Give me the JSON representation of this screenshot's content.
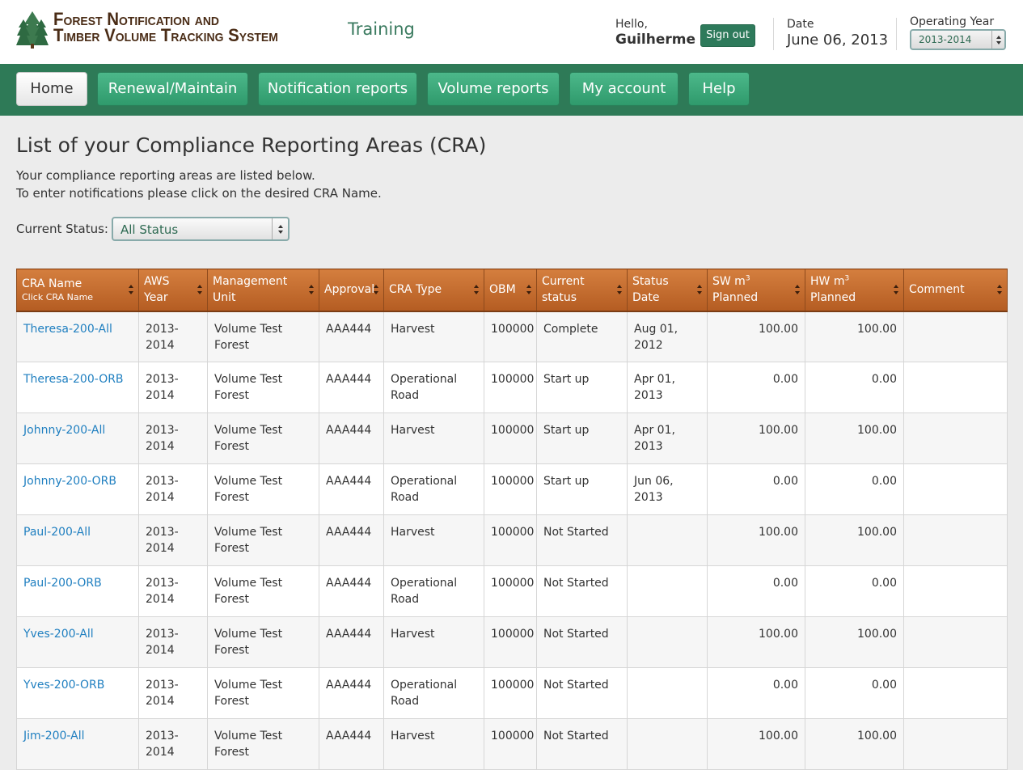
{
  "header": {
    "logo_line1": "Forest Notification and",
    "logo_line2": "Timber Volume Tracking System",
    "environment": "Training",
    "hello_label": "Hello,",
    "user_name": "Guilherme",
    "signout_label": "Sign out",
    "date_label": "Date",
    "date_value": "June 06, 2013",
    "operating_year_label": "Operating Year",
    "operating_year_value": "2013-2014"
  },
  "nav": {
    "items": [
      {
        "label": "Home",
        "active": true
      },
      {
        "label": "Renewal/Maintain"
      },
      {
        "label": "Notification reports"
      },
      {
        "label": "Volume reports"
      },
      {
        "label": "My account"
      },
      {
        "label": "Help"
      }
    ]
  },
  "main": {
    "title": "List of your Compliance Reporting Areas (CRA)",
    "intro_line1": "Your compliance reporting areas are listed below.",
    "intro_line2": "To enter notifications please click on the desired CRA Name.",
    "status_filter_label": "Current Status:",
    "status_filter_value": "All Status"
  },
  "table": {
    "headers": {
      "cra_name": "CRA Name",
      "cra_name_sub": "Click CRA Name",
      "aws_year_1": "AWS",
      "aws_year_2": "Year",
      "management_unit": "Management Unit",
      "approval": "Approval",
      "cra_type": "CRA Type",
      "obm": "OBM",
      "current_status_1": "Current",
      "current_status_2": "status",
      "status_date": "Status Date",
      "sw_1": "SW m",
      "sw_sup": "3",
      "sw_2": "Planned",
      "hw_1": "HW m",
      "hw_sup": "3",
      "hw_2": "Planned",
      "comment": "Comment"
    },
    "rows": [
      {
        "cra_name": "Theresa-200-All",
        "aws_year_1": "2013-",
        "aws_year_2": "2014",
        "mu_1": "Volume Test",
        "mu_2": "Forest",
        "approval": "AAA444",
        "type_1": "Harvest",
        "type_2": "",
        "obm": "100000",
        "status": "Complete",
        "status_date": "Aug 01, 2012",
        "sw": "100.00",
        "hw": "100.00",
        "comment": ""
      },
      {
        "cra_name": "Theresa-200-ORB",
        "aws_year_1": "2013-",
        "aws_year_2": "2014",
        "mu_1": "Volume Test",
        "mu_2": "Forest",
        "approval": "AAA444",
        "type_1": "Operational",
        "type_2": "Road",
        "obm": "100000",
        "status": "Start up",
        "status_date": "Apr 01, 2013",
        "sw": "0.00",
        "hw": "0.00",
        "comment": ""
      },
      {
        "cra_name": "Johnny-200-All",
        "aws_year_1": "2013-",
        "aws_year_2": "2014",
        "mu_1": "Volume Test",
        "mu_2": "Forest",
        "approval": "AAA444",
        "type_1": "Harvest",
        "type_2": "",
        "obm": "100000",
        "status": "Start up",
        "status_date": "Apr 01, 2013",
        "sw": "100.00",
        "hw": "100.00",
        "comment": ""
      },
      {
        "cra_name": "Johnny-200-ORB",
        "aws_year_1": "2013-",
        "aws_year_2": "2014",
        "mu_1": "Volume Test",
        "mu_2": "Forest",
        "approval": "AAA444",
        "type_1": "Operational",
        "type_2": "Road",
        "obm": "100000",
        "status": "Start up",
        "status_date": "Jun 06, 2013",
        "sw": "0.00",
        "hw": "0.00",
        "comment": ""
      },
      {
        "cra_name": "Paul-200-All",
        "aws_year_1": "2013-",
        "aws_year_2": "2014",
        "mu_1": "Volume Test",
        "mu_2": "Forest",
        "approval": "AAA444",
        "type_1": "Harvest",
        "type_2": "",
        "obm": "100000",
        "status": "Not Started",
        "status_date": "",
        "sw": "100.00",
        "hw": "100.00",
        "comment": ""
      },
      {
        "cra_name": "Paul-200-ORB",
        "aws_year_1": "2013-",
        "aws_year_2": "2014",
        "mu_1": "Volume Test",
        "mu_2": "Forest",
        "approval": "AAA444",
        "type_1": "Operational",
        "type_2": "Road",
        "obm": "100000",
        "status": "Not Started",
        "status_date": "",
        "sw": "0.00",
        "hw": "0.00",
        "comment": ""
      },
      {
        "cra_name": "Yves-200-All",
        "aws_year_1": "2013-",
        "aws_year_2": "2014",
        "mu_1": "Volume Test",
        "mu_2": "Forest",
        "approval": "AAA444",
        "type_1": "Harvest",
        "type_2": "",
        "obm": "100000",
        "status": "Not Started",
        "status_date": "",
        "sw": "100.00",
        "hw": "100.00",
        "comment": ""
      },
      {
        "cra_name": "Yves-200-ORB",
        "aws_year_1": "2013-",
        "aws_year_2": "2014",
        "mu_1": "Volume Test",
        "mu_2": "Forest",
        "approval": "AAA444",
        "type_1": "Operational",
        "type_2": "Road",
        "obm": "100000",
        "status": "Not Started",
        "status_date": "",
        "sw": "0.00",
        "hw": "0.00",
        "comment": ""
      },
      {
        "cra_name": "Jim-200-All",
        "aws_year_1": "2013-",
        "aws_year_2": "2014",
        "mu_1": "Volume Test",
        "mu_2": "Forest",
        "approval": "AAA444",
        "type_1": "Harvest",
        "type_2": "",
        "obm": "100000",
        "status": "Not Started",
        "status_date": "",
        "sw": "100.00",
        "hw": "100.00",
        "comment": ""
      }
    ]
  },
  "colors": {
    "brand_green": "#2e7a57",
    "header_orange": "#c66e30",
    "link_blue": "#1f7fc0",
    "logo_brown": "#4a2c16"
  },
  "icons": {
    "logo": "pine-trees-icon",
    "sort": "sort-arrows-icon",
    "select": "select-arrows-icon"
  }
}
